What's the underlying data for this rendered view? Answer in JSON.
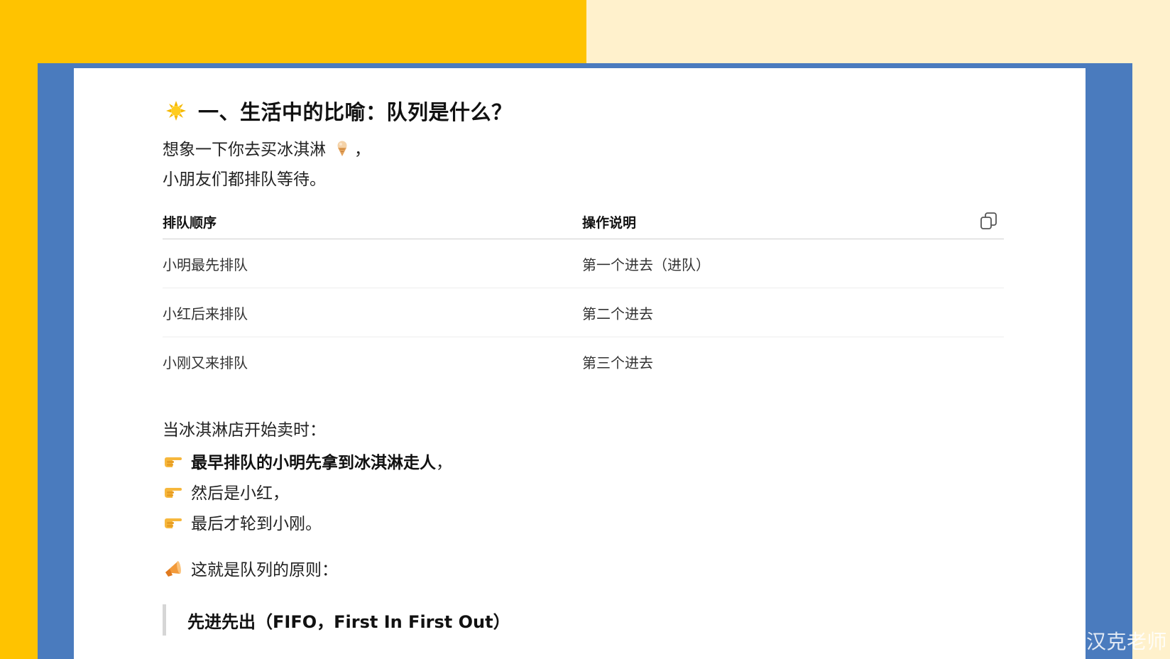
{
  "colors": {
    "left_background": "#FFC300",
    "right_background": "#FFF1CC",
    "frame": "#4A7BBE",
    "page": "#FFFFFF"
  },
  "section": {
    "icon": "sun-icon",
    "title": "一、生活中的比喻：队列是什么？"
  },
  "intro": {
    "line1_text": "想象一下你去买冰淇淋",
    "line1_icon": "ice-cream-icon",
    "line1_suffix": "，",
    "line2": "小朋友们都排队等待。"
  },
  "table": {
    "headers": [
      "排队顺序",
      "操作说明"
    ],
    "copy_icon": "copy-icon",
    "rows": [
      [
        "小明最先排队",
        "第一个进去（进队）"
      ],
      [
        "小红后来排队",
        "第二个进去"
      ],
      [
        "小刚又来排队",
        "第三个进去"
      ]
    ]
  },
  "sale": {
    "lead": "当冰淇淋店开始卖时：",
    "bullet_icon": "pointing-hand-icon",
    "bullets": [
      {
        "bold": "最早排队的小明先拿到冰淇淋走人",
        "rest": "，"
      },
      {
        "bold": "",
        "rest": "然后是小红，"
      },
      {
        "bold": "",
        "rest": "最后才轮到小刚。"
      }
    ]
  },
  "principle": {
    "icon": "megaphone-icon",
    "text": "这就是队列的原则："
  },
  "quote": "先进先出（FIFO，First In First Out）",
  "watermark": "CSDN @汉克老师"
}
